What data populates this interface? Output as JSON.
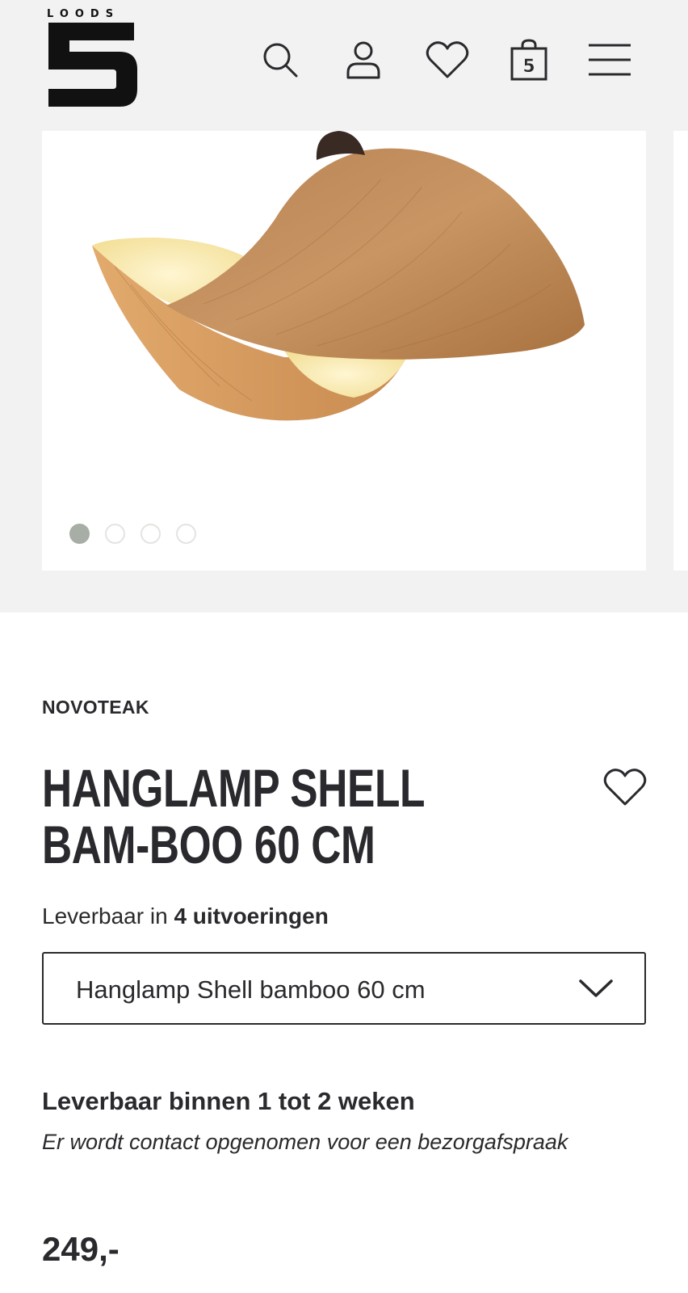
{
  "header": {
    "logo_text": "LOODS",
    "logo_number": "5",
    "cart_count": "5"
  },
  "icons": {
    "search": "search-icon",
    "account": "user-icon",
    "wishlist": "heart-icon",
    "cart": "shopping-bag-icon",
    "menu": "hamburger-menu-icon",
    "dropdown": "chevron-down-icon"
  },
  "gallery": {
    "slide_count": 4,
    "active_index": 0,
    "image_alt": "Hanglamp Shell bamboo"
  },
  "product": {
    "brand": "NOVOTEAK",
    "title": "HANGLAMP SHELL BAM-BOO 60 CM",
    "variants_prefix": "Leverbaar in",
    "variants_count_label": "4 uitvoeringen",
    "selected_variant": "Hanglamp Shell bamboo 60 cm",
    "delivery_title": "Leverbaar binnen 1 tot 2 weken",
    "delivery_note": "Er wordt contact opgenomen voor een bezorgafspraak",
    "price": "249,-"
  },
  "colors": {
    "text": "#2a2a2e",
    "header_bg": "#f2f2f2",
    "dot_active": "#a7aea5",
    "dot_inactive_border": "#e3e5e0"
  }
}
